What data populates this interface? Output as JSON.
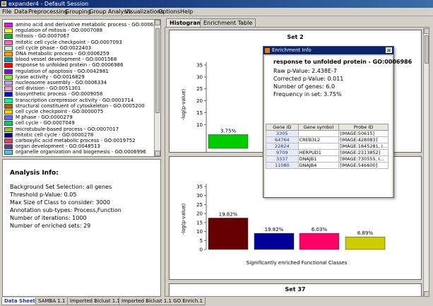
{
  "window": {
    "title": "expander4 - Default Session"
  },
  "menu": [
    "File",
    "Data",
    "Preprocessing",
    "Grouping",
    "Group Analysis",
    "Visualizations",
    "Options",
    "Help"
  ],
  "go_list": [
    {
      "label": "amino acid and derivative metabolic process - GO:0006519",
      "color": "#ff00ff"
    },
    {
      "label": "regulation of mitosis - GO:0007088",
      "color": "#ffff00"
    },
    {
      "label": "mitosis - GO:0007067",
      "color": "#00c000"
    },
    {
      "label": "mitotic cell cycle checkpoint - GO:0007093",
      "color": "#ff66cc"
    },
    {
      "label": "cell cycle phase - GO:0022403",
      "color": "#c0ffc0"
    },
    {
      "label": "DNA metabolic process - GO:0006259",
      "color": "#ff9900"
    },
    {
      "label": "blood vessel development - GO:0001568",
      "color": "#009999"
    },
    {
      "label": "response to unfolded protein - GO:0006986",
      "color": "#ff0000"
    },
    {
      "label": "regulation of apoptosis - GO:0042981",
      "color": "#8000ff"
    },
    {
      "label": "lyase activity - GO:0016829",
      "color": "#80ff00"
    },
    {
      "label": "nucleosome assembly - GO:0006334",
      "color": "#cc99ff"
    },
    {
      "label": "cell division - GO:0051301",
      "color": "#ff99cc"
    },
    {
      "label": "biosynthetic process - GO:0009058",
      "color": "#0000ff"
    },
    {
      "label": "transcription corepressor activity - GO:0003714",
      "color": "#00ff99"
    },
    {
      "label": "structural constituent of cytoskeleton - GO:0005200",
      "color": "#996600"
    },
    {
      "label": "cell cycle checkpoint - GO:0000075",
      "color": "#ffcc00"
    },
    {
      "label": "M phase - GO:0000279",
      "color": "#6666ff"
    },
    {
      "label": "cell cycle - GO:0007049",
      "color": "#00cc66"
    },
    {
      "label": "microtubule-based process - GO:0007017",
      "color": "#99cc00"
    },
    {
      "label": "mitotic cell cycle - GO:0000278",
      "color": "#000099"
    },
    {
      "label": "carboxylic acid metabolic process - GO:0019752",
      "color": "#ff3366"
    },
    {
      "label": "organ development - GO:0048513",
      "color": "#663399"
    },
    {
      "label": "organelle organization and biogenesis - GO:0006996",
      "color": "#33ccff"
    }
  ],
  "analysis_info": {
    "heading": "Analysis Info:",
    "rows": [
      "Background Set Selection: all genes",
      "Threshold p-Value:      0.05",
      "Max Size of Class to consider:       3000",
      "Annotation sub-types:  Process,Function",
      "Number of iterations:    1000",
      "Number of enriched sets: 29"
    ]
  },
  "tabs": [
    "Histograms",
    "Enrichment Table"
  ],
  "charts": {
    "top": {
      "title": "Set 2",
      "ylabel": "-log(p-value)",
      "ticks": [
        "35",
        "30",
        "25",
        "20",
        "15",
        "10"
      ]
    },
    "bottom": {
      "ylabel": "-log(p-value)",
      "ticks": [
        "35",
        "30",
        "25",
        "20",
        "15",
        "10",
        "5",
        "0"
      ],
      "xlabel": "Significantly enriched Functional Classes"
    },
    "next_title": "Set 37"
  },
  "chart_data": [
    {
      "type": "bar",
      "title": "Set 2",
      "ylabel": "-log(p-value)",
      "ylim": [
        0,
        35
      ],
      "bars": [
        {
          "label": "3.75%",
          "value": 5.8,
          "color": "#00cc00"
        }
      ]
    },
    {
      "type": "bar",
      "ylabel": "-log(p-value)",
      "xlabel": "Significantly enriched Functional Classes",
      "ylim": [
        0,
        35
      ],
      "bars": [
        {
          "label": "19.82%",
          "value": 17.5,
          "color": "#660000"
        },
        {
          "label": "19.82%",
          "value": 9.0,
          "color": "#000099"
        },
        {
          "label": "6.03%",
          "value": 9.0,
          "color": "#ff0066"
        },
        {
          "label": "6.89%",
          "value": 7.0,
          "color": "#cccc00"
        }
      ]
    }
  ],
  "dialog": {
    "title": "Enrichment Info",
    "term": "response to unfolded protein - GO:0006986",
    "stats": [
      "Raw p-Value: 2.438E-7",
      "Corrected p-Value: 0.011",
      "Number of genes: 6.0",
      "Frequency in set: 3.75%"
    ],
    "columns": [
      "Gene ID",
      "Gene symbol",
      "Probe ID"
    ],
    "rows": [
      [
        "3305",
        "",
        "[IMAGE:50615]"
      ],
      [
        "64764",
        "CREB3L2",
        "[IMAGE:428083]"
      ],
      [
        "22824",
        "",
        "[IMAGE:1845281, I..."
      ],
      [
        "9709",
        "HERPUD1",
        "[IMAGE:2313852]"
      ],
      [
        "3337",
        "DNAJB1",
        "[IMAGE:730555, I..."
      ],
      [
        "11080",
        "DNAJB4",
        "[IMAGE:546600]"
      ]
    ]
  },
  "bottom_tabs": [
    "Data Sheet 1",
    "SAMBA 1.1",
    "Imported Biclust 1.1",
    "Imported Biclust 1.1 GO Enrich.1"
  ]
}
